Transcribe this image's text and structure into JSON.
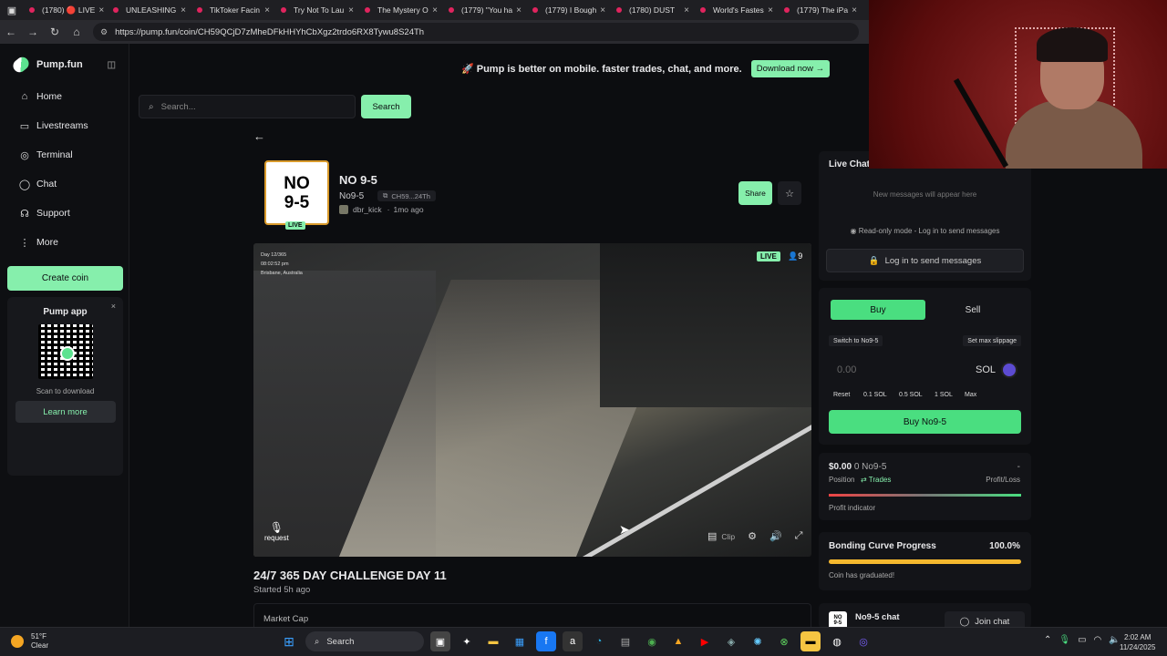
{
  "browser": {
    "tabs": [
      {
        "label": "(1780) 🔴 LIVE"
      },
      {
        "label": "UNLEASHING"
      },
      {
        "label": "TikToker Facin"
      },
      {
        "label": "Try Not To Lau"
      },
      {
        "label": "The Mystery O"
      },
      {
        "label": "(1779) \"You ha"
      },
      {
        "label": "(1779) I Bough"
      },
      {
        "label": "(1780) DUST"
      },
      {
        "label": "World's Fastes"
      },
      {
        "label": "(1779) The iPa"
      }
    ],
    "url": "https://pump.fun/coin/CH59QCjD7zMheDFkHHYhCbXgz2trdo6RX8Tywu8S24Th"
  },
  "sidebar": {
    "brand": "Pump.fun",
    "items": [
      {
        "label": "Home",
        "icon": "home-icon"
      },
      {
        "label": "Livestreams",
        "icon": "livestream-icon"
      },
      {
        "label": "Terminal",
        "icon": "terminal-icon"
      },
      {
        "label": "Chat",
        "icon": "chat-icon"
      },
      {
        "label": "Support",
        "icon": "support-icon"
      },
      {
        "label": "More",
        "icon": "more-icon"
      }
    ],
    "create_coin": "Create coin",
    "app_card": {
      "title": "Pump app",
      "scan": "Scan to download",
      "learn_more": "Learn more"
    }
  },
  "banner": {
    "text": "🚀 Pump is better on mobile. faster trades, chat, and more.",
    "download": "Download now →"
  },
  "search": {
    "placeholder": "Search...",
    "button": "Search"
  },
  "coin": {
    "thumb_line1": "NO",
    "thumb_line2": "9-5",
    "live": "LIVE",
    "name": "NO 9-5",
    "ticker": "No9-5",
    "ca_short": "CH59...24Th",
    "creator": "dbr_kick",
    "age": "1mo ago",
    "share": "Share"
  },
  "stream": {
    "overlay_day": "Day 12/365",
    "overlay_time": "08:02:52 pm",
    "overlay_place": "Brisbane, Australia",
    "live": "LIVE",
    "viewers": "9",
    "request": "request",
    "clip": "Clip",
    "title": "24/7 365 DAY CHALLENGE DAY 11",
    "started": "Started 5h ago",
    "market_cap_label": "Market Cap"
  },
  "live_chat": {
    "title": "Live Chat",
    "empty": "New messages will appear here",
    "readonly": "Read-only mode - Log in to send messages",
    "login": "Log in to send messages"
  },
  "trade": {
    "buy_tab": "Buy",
    "sell_tab": "Sell",
    "switch": "Switch to No9-5",
    "slippage": "Set max slippage",
    "amount": "0.00",
    "currency": "SOL",
    "presets": [
      "Reset",
      "0.1 SOL",
      "0.5 SOL",
      "1 SOL",
      "Max"
    ],
    "buy_button": "Buy No9-5"
  },
  "position": {
    "value": "$0.00",
    "amount": "0 No9-5",
    "dash": "-",
    "label": "Position",
    "trades": "Trades",
    "pl": "Profit/Loss",
    "indicator": "Profit indicator"
  },
  "bonding": {
    "title": "Bonding Curve Progress",
    "percent": "100.0%",
    "progress": 1.0,
    "status": "Coin has graduated!"
  },
  "token_chat": {
    "title": "No9-5 chat",
    "join": "Join chat"
  },
  "taskbar": {
    "temp": "51°F",
    "weather": "Clear",
    "search": "Search",
    "time": "2:02 AM",
    "date": "11/24/2025"
  },
  "colors": {
    "accent": "#86efac",
    "buy": "#4ade80",
    "progress": "#f5b82e"
  }
}
